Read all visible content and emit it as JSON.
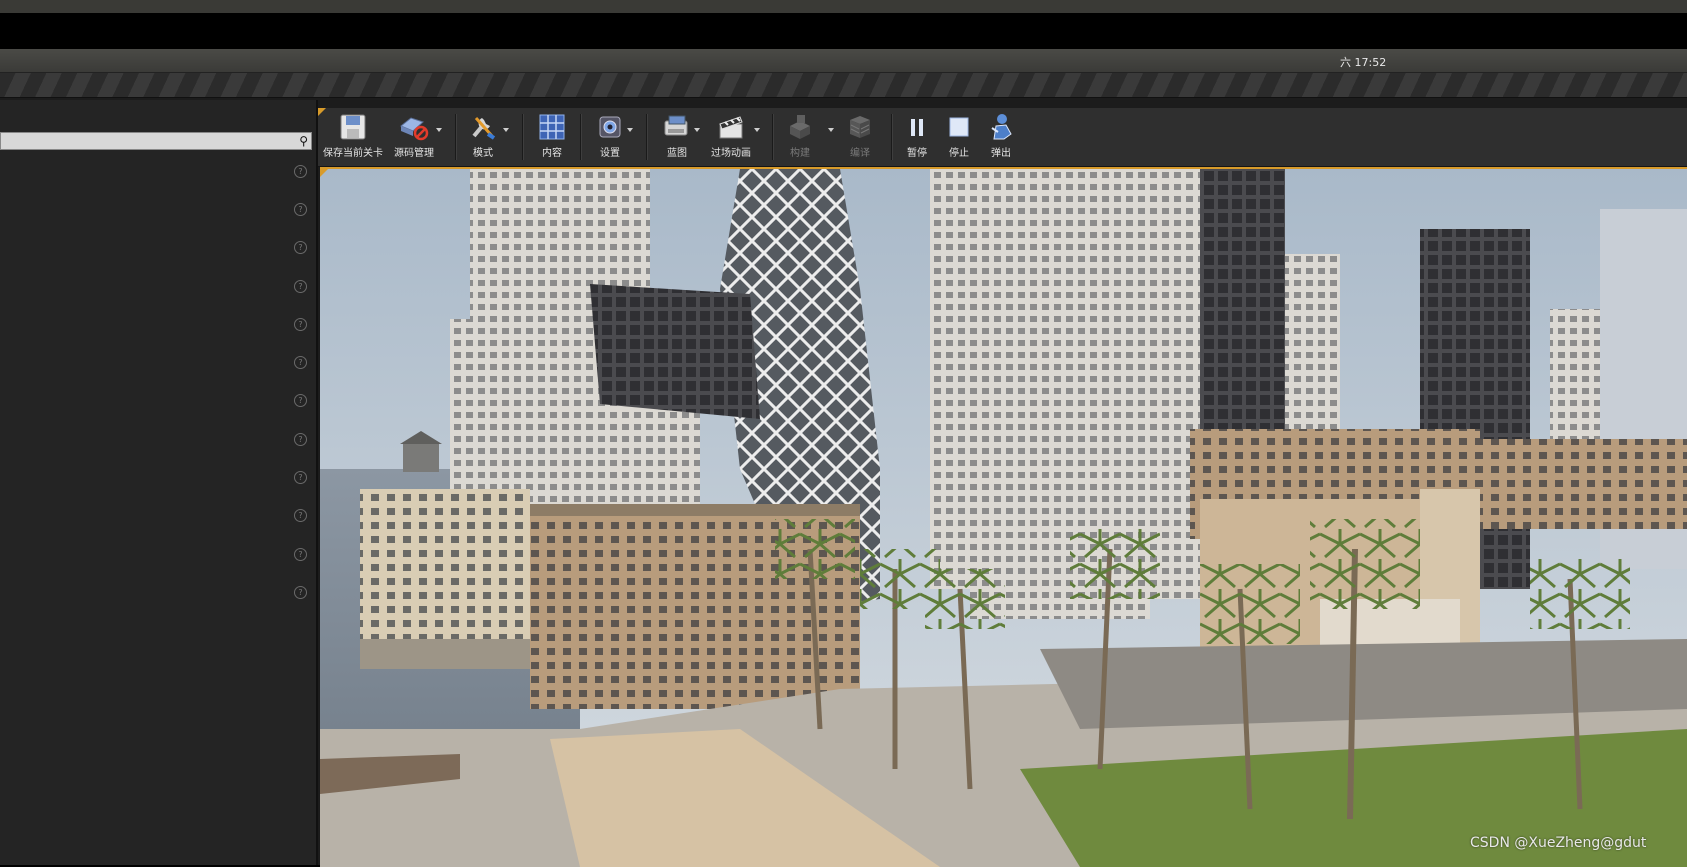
{
  "statusbar": {
    "clock": "六 17:52"
  },
  "left_panel": {
    "search": {
      "value": "",
      "placeholder": ""
    },
    "help_rows": [
      "?",
      "?",
      "?",
      "?",
      "?",
      "?",
      "?",
      "?",
      "?",
      "?",
      "?",
      "?"
    ]
  },
  "toolbar": {
    "buttons": [
      {
        "label": "保存当前关卡",
        "icon": "save-icon",
        "enabled": true
      },
      {
        "label": "源码管理",
        "icon": "source-control-icon",
        "enabled": true,
        "dropdown": true
      },
      {
        "label": "模式",
        "icon": "modes-icon",
        "enabled": true,
        "dropdown": true
      },
      {
        "label": "内容",
        "icon": "content-icon",
        "enabled": true
      },
      {
        "label": "设置",
        "icon": "settings-icon",
        "enabled": true,
        "dropdown": true
      },
      {
        "label": "蓝图",
        "icon": "blueprint-icon",
        "enabled": true,
        "dropdown": true
      },
      {
        "label": "过场动画",
        "icon": "cinematics-icon",
        "enabled": true,
        "dropdown": true
      },
      {
        "label": "构建",
        "icon": "build-icon",
        "enabled": false,
        "dropdown": true
      },
      {
        "label": "编译",
        "icon": "compile-icon",
        "enabled": false
      },
      {
        "label": "暂停",
        "icon": "pause-icon",
        "enabled": true
      },
      {
        "label": "停止",
        "icon": "stop-icon",
        "enabled": true
      },
      {
        "label": "弹出",
        "icon": "eject-icon",
        "enabled": true
      }
    ]
  },
  "viewport": {
    "scene": "city-waterfront-viewport"
  },
  "watermark": "CSDN @XueZheng@gdut",
  "colors": {
    "accent": "#d89b2a",
    "toolbar": "#2f2f2f",
    "panel": "#242424"
  }
}
